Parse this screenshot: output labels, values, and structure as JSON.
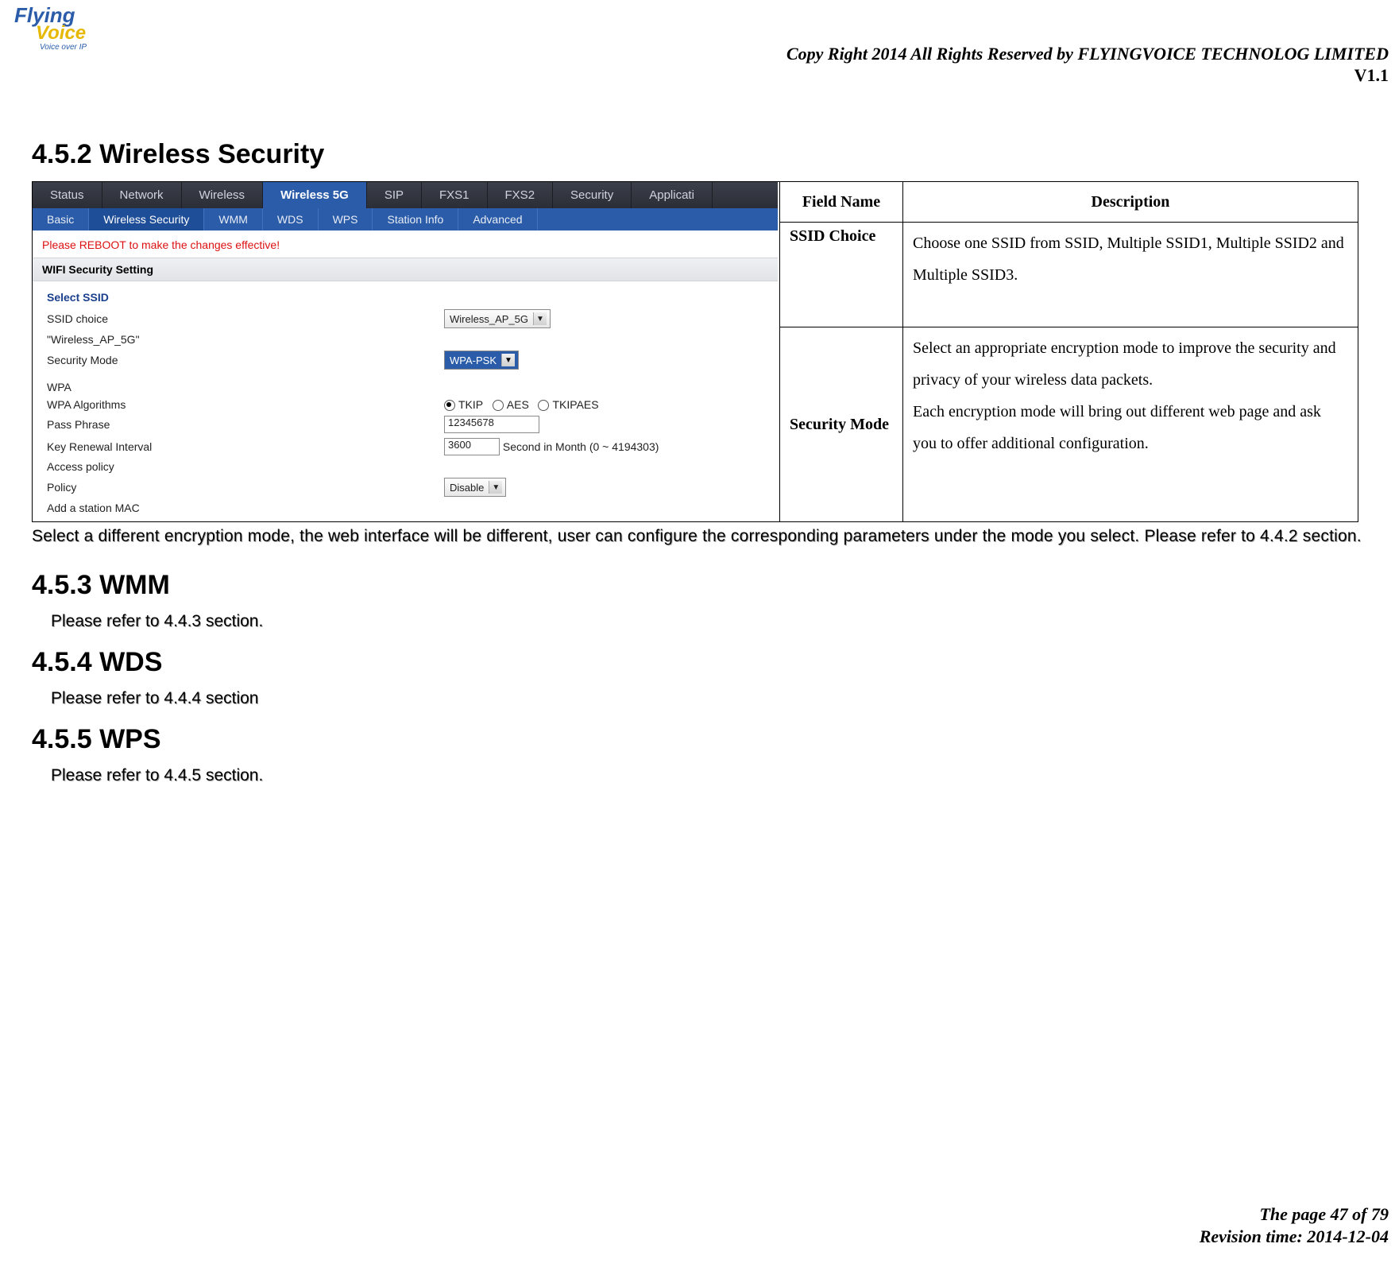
{
  "logo": {
    "line1": "Flying",
    "line2": "Voice",
    "line3": "Voice over IP"
  },
  "header": {
    "copyright": "Copy Right 2014 All Rights Reserved by FLYINGVOICE TECHNOLOG LIMITED",
    "version": "V1.1"
  },
  "sections": {
    "s452": "4.5.2 Wireless Security",
    "s453": "4.5.3 WMM",
    "s454": "4.5.4 WDS",
    "s455": "4.5.5 WPS"
  },
  "screenshot": {
    "tabs1": [
      "Status",
      "Network",
      "Wireless",
      "Wireless 5G",
      "SIP",
      "FXS1",
      "FXS2",
      "Security",
      "Applicati"
    ],
    "tabs1_active_index": 3,
    "tabs2": [
      "Basic",
      "Wireless Security",
      "WMM",
      "WDS",
      "WPS",
      "Station Info",
      "Advanced"
    ],
    "tabs2_active_index": 1,
    "reboot": "Please REBOOT to make the changes effective!",
    "panel_title": "WIFI Security Setting",
    "subhead": "Select SSID",
    "ssid_choice_label": "SSID choice",
    "ssid_choice_value": "Wireless_AP_5G",
    "ssid_name": "\"Wireless_AP_5G\"",
    "security_mode_label": "Security Mode",
    "security_mode_value": "WPA-PSK",
    "wpa_label": "WPA",
    "wpa_alg_label": "WPA Algorithms",
    "wpa_alg_options": [
      "TKIP",
      "AES",
      "TKIPAES"
    ],
    "wpa_alg_selected_index": 0,
    "pass_label": "Pass Phrase",
    "pass_value": "12345678",
    "renew_label": "Key Renewal Interval",
    "renew_value": "3600",
    "renew_suffix": "Second in Month   (0 ~ 4194303)",
    "access_label": "Access policy",
    "policy_label": "Policy",
    "policy_value": "Disable",
    "addmac_label": "Add a station MAC"
  },
  "table": {
    "th_field": "Field Name",
    "th_desc": "Description",
    "rows": [
      {
        "field": "SSID Choice",
        "desc": "Choose one SSID from SSID, Multiple SSID1, Multiple SSID2 and Multiple SSID3."
      },
      {
        "field": "Security Mode",
        "desc": "Select an appropriate encryption mode to improve the security and privacy of your wireless data packets.\nEach encryption mode will bring out different web page and ask you to offer additional configuration."
      }
    ]
  },
  "note_452": "Select a different encryption mode, the web interface will be different, user can configure the corresponding parameters under the mode you select. Please refer to 4.4.2 section.",
  "refer_453": "Please refer to 4.4.3 section.",
  "refer_454": "Please refer to 4.4.4 section",
  "refer_455": "Please refer to 4.4.5 section.",
  "footer": {
    "page": "The page 47 of 79",
    "rev": "Revision time: 2014-12-04"
  }
}
